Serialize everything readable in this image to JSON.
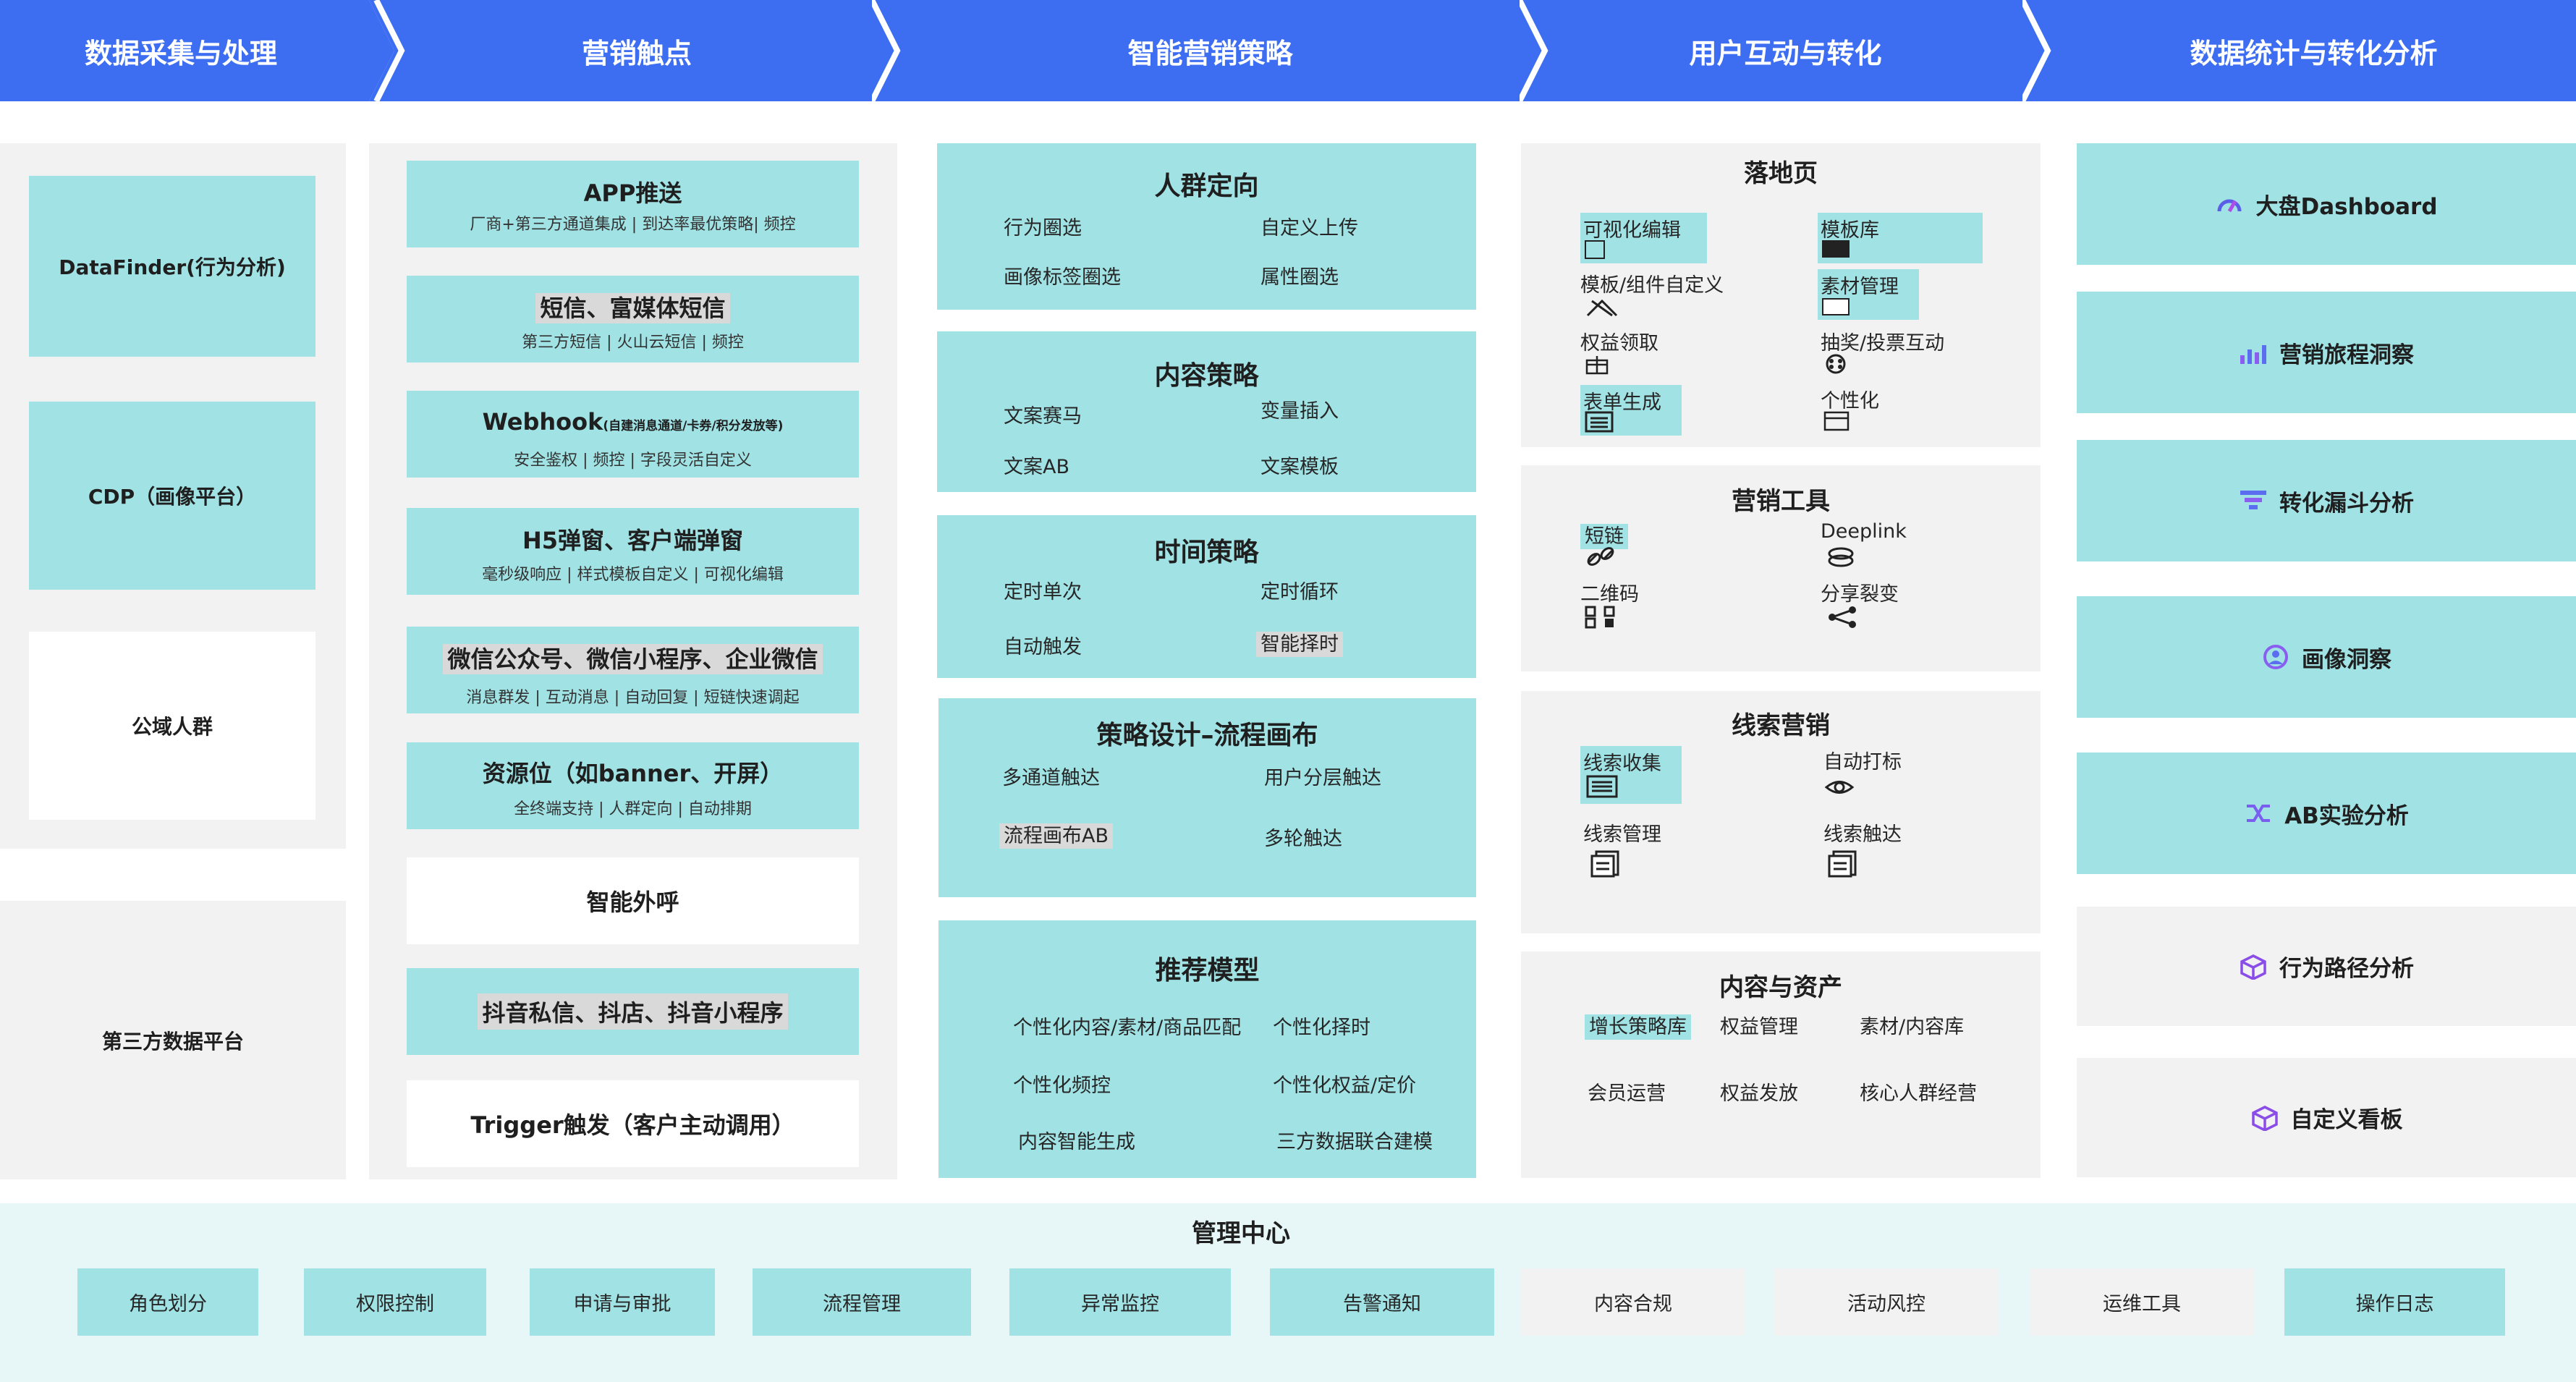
{
  "header": {
    "stages": [
      {
        "label": "数据采集与处理"
      },
      {
        "label": "营销触点"
      },
      {
        "label": "智能营销策略"
      },
      {
        "label": "用户互动与转化"
      },
      {
        "label": "数据统计与转化分析"
      }
    ],
    "color": "#3d6ef2"
  },
  "colors": {
    "teal": "#a1e3e5",
    "grey": "#f2f2f2",
    "header_blue": "#3d6ef2",
    "mgmt_bg": "#e7f7f7"
  },
  "data_collection": {
    "items": [
      "DataFinder(行为分析)",
      "CDP（画像平台）",
      "公域人群"
    ],
    "third_party": "第三方数据平台"
  },
  "touchpoints": [
    {
      "title": "APP推送",
      "sub": "厂商+第三方通道集成 | 到达率最优策略| 频控"
    },
    {
      "title": "短信、富媒体短信",
      "sub": "第三方短信 | 火山云短信 | 频控"
    },
    {
      "title": "Webhook",
      "title_small": "(自建消息通道/卡券/积分发放等)",
      "sub": "安全鉴权 | 频控 |  字段灵活自定义"
    },
    {
      "title": "H5弹窗、客户端弹窗",
      "sub": "毫秒级响应 | 样式模板自定义 |  可视化编辑"
    },
    {
      "title": "微信公众号、微信小程序、企业微信",
      "sub": "消息群发 | 互动消息 |  自动回复 | 短链快速调起"
    },
    {
      "title": "资源位（如banner、开屏）",
      "sub": "全终端支持 | 人群定向 |  自动排期"
    },
    {
      "title": "智能外呼"
    },
    {
      "title": "抖音私信、抖店、抖音小程序"
    },
    {
      "title": "Trigger触发（客户主动调用）"
    }
  ],
  "strategy": [
    {
      "title": "人群定向",
      "items": [
        "行为圈选",
        "自定义上传",
        "画像标签圈选",
        "属性圈选"
      ]
    },
    {
      "title": "内容策略",
      "items": [
        "文案赛马",
        "变量插入",
        "文案AB",
        "文案模板"
      ]
    },
    {
      "title": "时间策略",
      "items": [
        "定时单次",
        "定时循环",
        "自动触发",
        "智能择时"
      ]
    },
    {
      "title": "策略设计–流程画布",
      "items": [
        "多通道触达",
        "用户分层触达",
        "流程画布AB",
        "多轮触达"
      ]
    },
    {
      "title": "推荐模型",
      "items": [
        "个性化内容/素材/商品匹配",
        "个性化择时",
        "个性化频控",
        "个性化权益/定价",
        "内容智能生成",
        "三方数据联合建模"
      ]
    }
  ],
  "interaction": {
    "landing": {
      "title": "落地页",
      "items": [
        "可视化编辑",
        "模板库",
        "模板/组件自定义",
        "素材管理",
        "权益领取",
        "抽奖/投票互动",
        "表单生成",
        "个性化"
      ]
    },
    "tools": {
      "title": "营销工具",
      "items": [
        "短链",
        "Deeplink",
        "二维码",
        "分享裂变"
      ]
    },
    "leads": {
      "title": "线索营销",
      "items": [
        "线索收集",
        "自动打标",
        "线索管理",
        "线索触达"
      ]
    },
    "assets": {
      "title": "内容与资产",
      "items": [
        "增长策略库",
        "权益管理",
        "素材/内容库",
        "会员运营",
        "权益发放",
        "核心人群经营"
      ]
    }
  },
  "analytics": [
    {
      "label": "大盘Dashboard",
      "icon": "dashboard-icon"
    },
    {
      "label": "营销旅程洞察",
      "icon": "bar-chart-icon"
    },
    {
      "label": "转化漏斗分析",
      "icon": "funnel-icon"
    },
    {
      "label": "画像洞察",
      "icon": "profile-icon"
    },
    {
      "label": "AB实验分析",
      "icon": "shuffle-icon"
    },
    {
      "label": "行为路径分析",
      "icon": "cube-icon"
    },
    {
      "label": "自定义看板",
      "icon": "cube-icon"
    }
  ],
  "management": {
    "title": "管理中心",
    "items": [
      "角色划分",
      "权限控制",
      "申请与审批",
      "流程管理",
      "异常监控",
      "告警通知",
      "内容合规",
      "活动风控",
      "运维工具",
      "操作日志"
    ]
  }
}
